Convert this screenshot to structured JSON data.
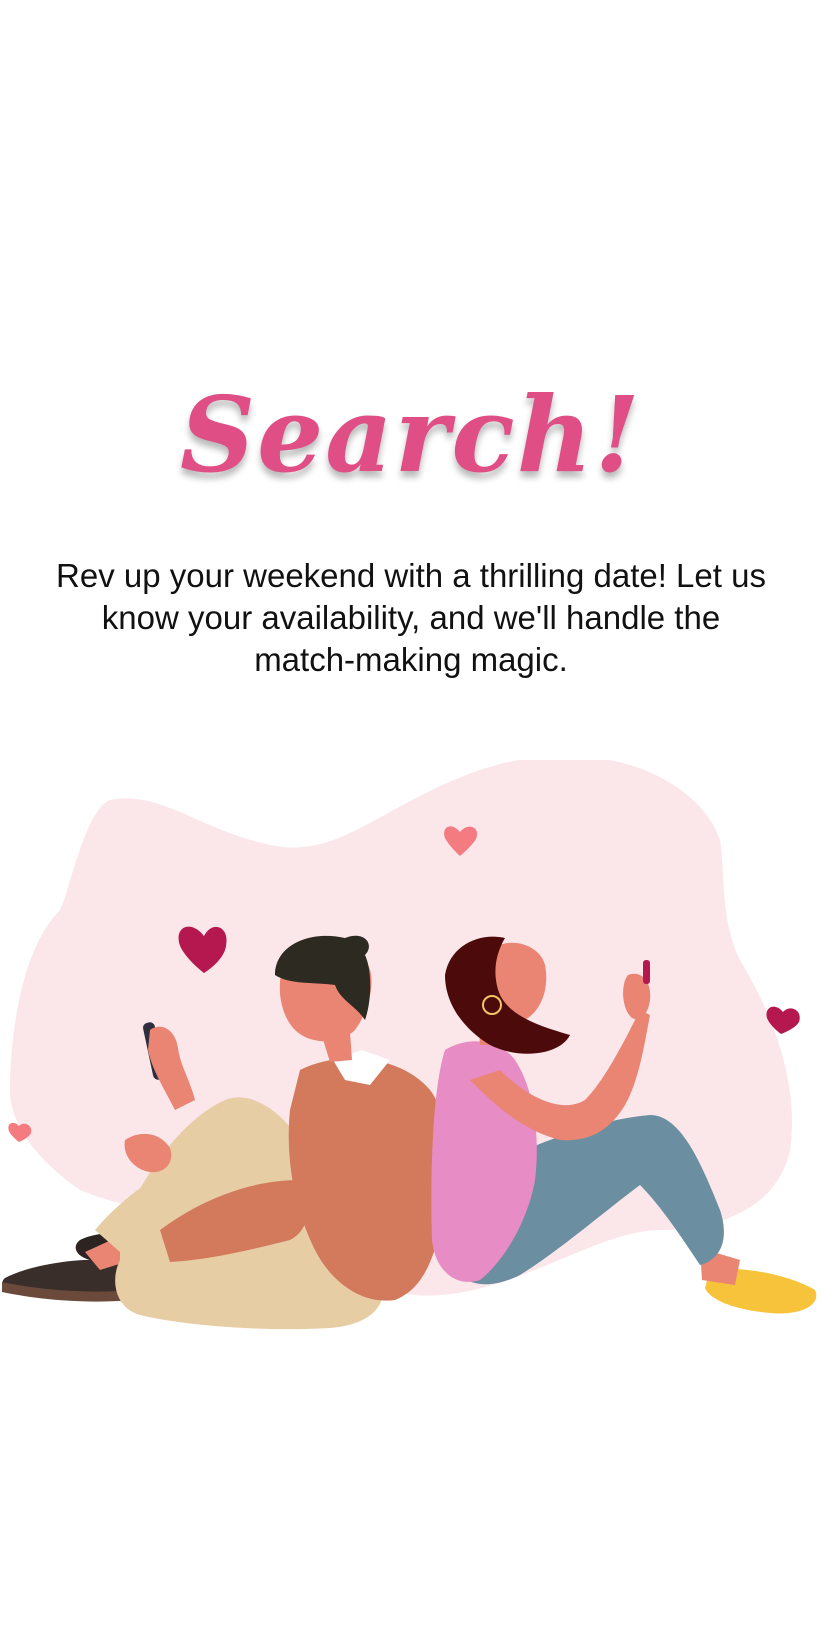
{
  "onboarding": {
    "title": "Search!",
    "description": "Rev up your weekend with a thrilling date! Let us know your availability, and we'll handle the match-making magic."
  },
  "illustration": {
    "icon": "couple-texting-illustration",
    "colors": {
      "blob": "#fbe6ea",
      "heart_dark": "#b5184f",
      "heart_light": "#f47b80",
      "title": "#df4f86"
    }
  }
}
